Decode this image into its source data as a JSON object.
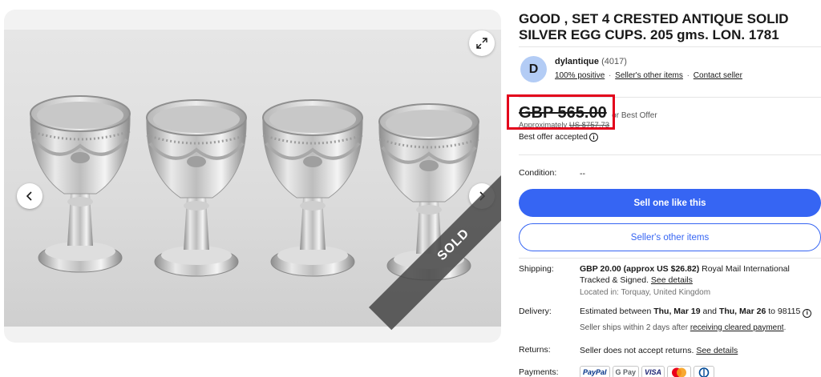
{
  "listing": {
    "title": "GOOD , SET 4 CRESTED ANTIQUE SOLID SILVER EGG CUPS. 205 gms. LON. 1781",
    "sold_label": "SOLD"
  },
  "seller": {
    "avatar_letter": "D",
    "name": "dylantique",
    "count": "(4017)",
    "positive": "100% positive",
    "sep": "·",
    "other_items": "Seller's other items",
    "contact": "Contact seller"
  },
  "price": {
    "amount": "GBP 565.00",
    "best_offer": "or Best Offer",
    "approx_prefix": "Approximately ",
    "approx_value": "US $757.73",
    "offer_accepted": "Best offer accepted",
    "info_glyph": "i"
  },
  "condition": {
    "label": "Condition:",
    "value": "--"
  },
  "buttons": {
    "sell_one": "Sell one like this",
    "other_items": "Seller's other items"
  },
  "shipping": {
    "label": "Shipping:",
    "cost": "GBP 20.00 (approx US $26.82)",
    "service": " Royal Mail International Tracked & Signed. ",
    "details_link": "See details",
    "location": "Located in: Torquay, United Kingdom"
  },
  "delivery": {
    "label": "Delivery:",
    "prefix": "Estimated between ",
    "date1": "Thu, Mar 19",
    "and": " and ",
    "date2": "Thu, Mar 26",
    "suffix": " to 98115 ",
    "ships_prefix": "Seller ships within 2 days after ",
    "ships_link": "receiving cleared payment",
    "ships_suffix": "."
  },
  "returns": {
    "label": "Returns:",
    "text": "Seller does not accept returns. ",
    "details_link": "See details"
  },
  "payments": {
    "label": "Payments:",
    "methods": [
      "PayPal",
      "G Pay",
      "VISA",
      "Mastercard",
      "Diners"
    ]
  },
  "colors": {
    "primary": "#3665f3",
    "highlight_box": "#e3001b",
    "avatar": "#b3ccf5"
  }
}
